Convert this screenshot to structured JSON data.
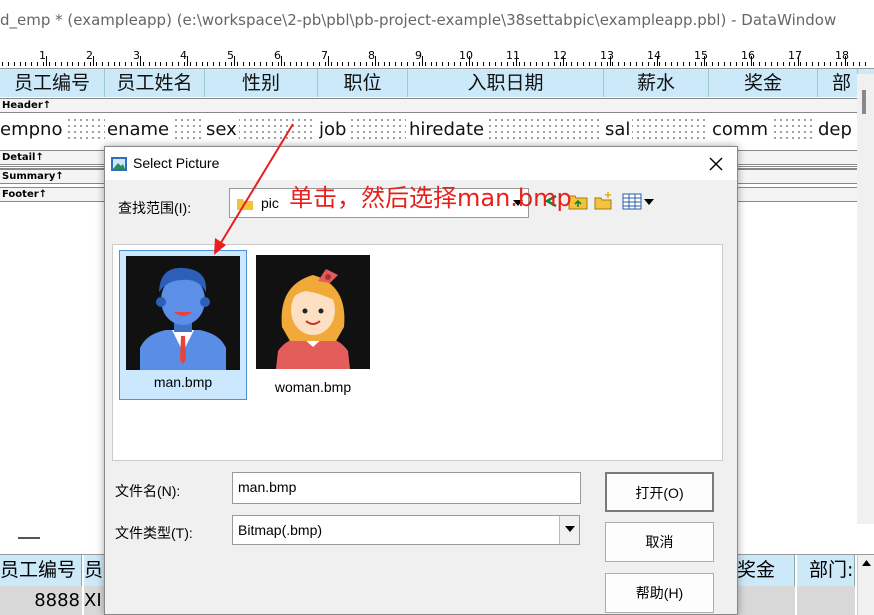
{
  "window": {
    "title": "d_emp * (exampleapp) (e:\\workspace\\2-pb\\pbl\\pb-project-example\\38settabpic\\exampleapp.pbl) - DataWindow"
  },
  "ruler": {
    "numbers": [
      "1",
      "2",
      "3",
      "4",
      "5",
      "6",
      "7",
      "8",
      "9",
      "10",
      "11",
      "12",
      "13",
      "14",
      "15",
      "16",
      "17",
      "18"
    ]
  },
  "columns": {
    "headers": [
      "员工编号",
      "员工姓名",
      "性别",
      "职位",
      "入职日期",
      "薪水",
      "奖金",
      "部"
    ],
    "fields": [
      "empno",
      "ename",
      "sex",
      "job",
      "hiredate",
      "sal",
      "comm",
      "dep"
    ]
  },
  "bands": {
    "header": "Header↑",
    "detail": "Detail↑",
    "summary": "Summary↑",
    "footer": "Footer↑"
  },
  "preview": {
    "headers": [
      "员工编号",
      "员",
      "奖金",
      "部门:"
    ],
    "row": [
      "8888",
      "XI"
    ]
  },
  "dialog": {
    "title": "Select Picture",
    "look_in_label": "查找范围(I):",
    "look_in_value": "pic",
    "files": [
      {
        "name": "man.bmp",
        "selected": true
      },
      {
        "name": "woman.bmp",
        "selected": false
      }
    ],
    "filename_label": "文件名(N):",
    "filename_value": "man.bmp",
    "filetype_label": "文件类型(T):",
    "filetype_value": "Bitmap(.bmp)",
    "open_button": "打开(O)",
    "cancel_button": "取消",
    "help_button": "帮助(H)",
    "close_icon": "close-icon"
  },
  "annotation": {
    "text": "单击，然后选择man.bmp",
    "color": "#e8201c"
  }
}
